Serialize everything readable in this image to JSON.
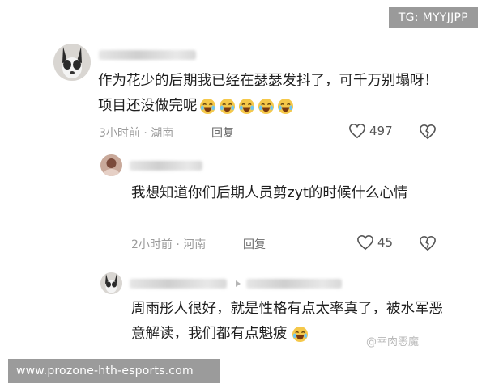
{
  "tg_label": "TG: MYYJJPP",
  "footer_text": "www.prozone-hth-esports.com",
  "watermark_text": "@幸肉恶魔",
  "comments": [
    {
      "text": "作为花少的后期我已经在瑟瑟发抖了，可千万别塌呀！项目还没做完呢",
      "time": "3小时前 · 湖南",
      "reply": "回复",
      "likes": "497",
      "emoji": "laugh-cry-icon"
    },
    {
      "text": "我想知道你们后期人员剪zyt的时候什么心情",
      "time": "2小时前 · 河南",
      "reply": "回复",
      "likes": "45"
    },
    {
      "text": "周雨彤人很好，就是性格有点太率真了，被水军恶意解读，我们都有点魁疲"
    }
  ],
  "colors": {
    "text": "#1f1f1f",
    "meta": "#9b9b9b",
    "badge": "#9a9a9a",
    "emoji": "#f5c84a"
  }
}
